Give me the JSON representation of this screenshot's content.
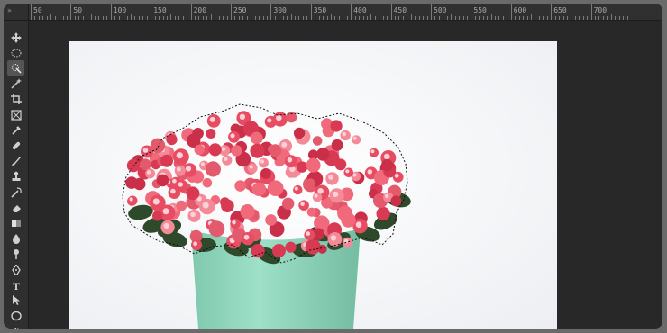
{
  "ruler": {
    "corner_label": "»",
    "labels": [
      {
        "value": "50",
        "text": "50"
      },
      {
        "value": "50",
        "text": "50"
      },
      {
        "value": "100",
        "text": "100"
      },
      {
        "value": "150",
        "text": "150"
      },
      {
        "value": "200",
        "text": "200"
      },
      {
        "value": "250",
        "text": "250"
      },
      {
        "value": "300",
        "text": "300"
      },
      {
        "value": "350",
        "text": "350"
      },
      {
        "value": "400",
        "text": "400"
      },
      {
        "value": "450",
        "text": "450"
      },
      {
        "value": "500",
        "text": "500"
      },
      {
        "value": "550",
        "text": "550"
      },
      {
        "value": "600",
        "text": "600"
      },
      {
        "value": "650",
        "text": "650"
      },
      {
        "value": "700",
        "text": "700"
      }
    ]
  },
  "toolbar": {
    "tools": [
      {
        "name": "move-tool",
        "icon": "move-icon",
        "active": false
      },
      {
        "name": "marquee-tool",
        "icon": "ellipse-marquee-icon",
        "active": false
      },
      {
        "name": "quick-selection-tool",
        "icon": "quick-selection-icon",
        "active": true
      },
      {
        "name": "magic-wand-tool",
        "icon": "magic-wand-icon",
        "active": false
      },
      {
        "name": "crop-tool",
        "icon": "crop-icon",
        "active": false
      },
      {
        "name": "frame-tool",
        "icon": "frame-icon",
        "active": false
      },
      {
        "name": "eyedropper-tool",
        "icon": "eyedropper-icon",
        "active": false
      },
      {
        "name": "healing-brush-tool",
        "icon": "bandage-icon",
        "active": false
      },
      {
        "name": "brush-tool",
        "icon": "brush-icon",
        "active": false
      },
      {
        "name": "clone-stamp-tool",
        "icon": "stamp-icon",
        "active": false
      },
      {
        "name": "history-brush-tool",
        "icon": "history-brush-icon",
        "active": false
      },
      {
        "name": "eraser-tool",
        "icon": "eraser-icon",
        "active": false
      },
      {
        "name": "gradient-tool",
        "icon": "gradient-icon",
        "active": false
      },
      {
        "name": "blur-tool",
        "icon": "drop-icon",
        "active": false
      },
      {
        "name": "dodge-tool",
        "icon": "dodge-icon",
        "active": false
      },
      {
        "name": "pen-tool",
        "icon": "pen-icon",
        "active": false
      },
      {
        "name": "type-tool",
        "icon": "type-icon",
        "active": false,
        "label": "T"
      },
      {
        "name": "path-selection-tool",
        "icon": "arrow-icon",
        "active": false
      },
      {
        "name": "shape-tool",
        "icon": "ellipse-shape-icon",
        "active": false
      },
      {
        "name": "hand-tool",
        "icon": "hand-icon",
        "active": false
      }
    ]
  },
  "colors": {
    "frame": "#282828",
    "canvas": "#f7f7fa",
    "pot": "#8fd3bb",
    "flowers": "#e84c62",
    "leaves": "#2f4a2a"
  }
}
